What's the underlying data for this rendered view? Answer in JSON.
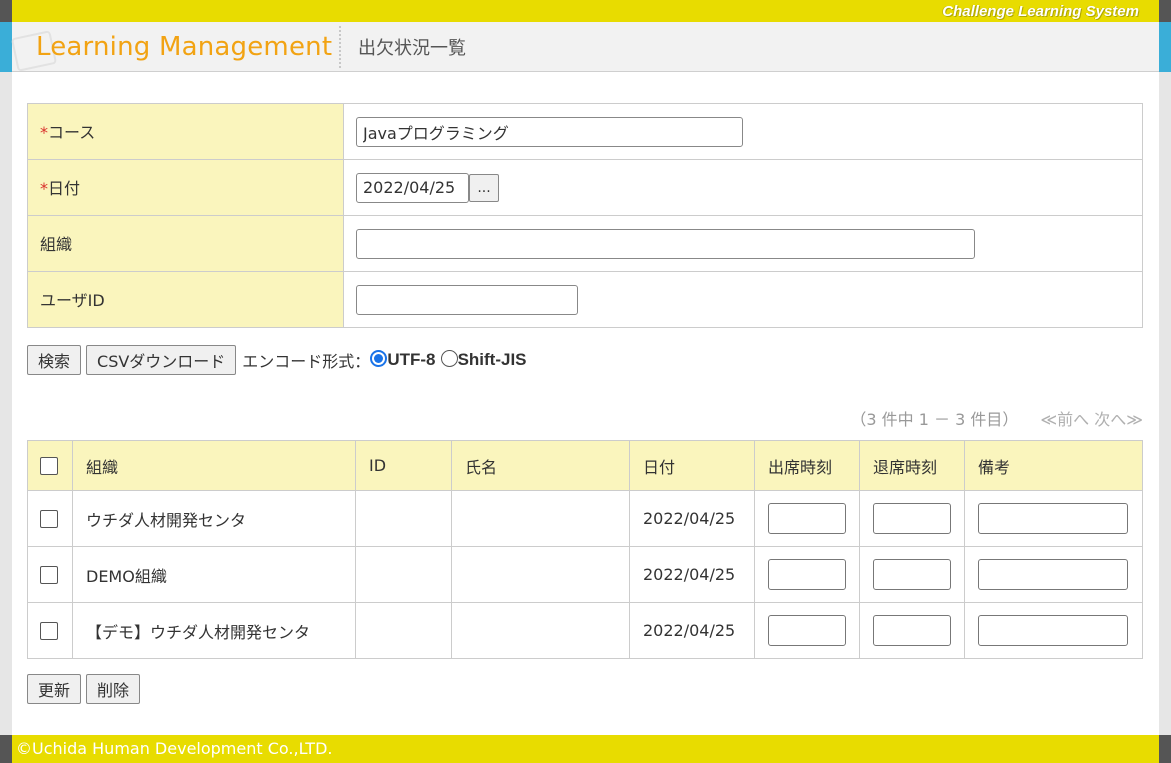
{
  "system": {
    "name": "Challenge Learning System"
  },
  "header": {
    "logo": "Learning Management",
    "page_title": "出欠状況一覧"
  },
  "search_form": {
    "course": {
      "required_mark": "*",
      "label": "コース",
      "value": "Javaプログラミング"
    },
    "date": {
      "required_mark": "*",
      "label": "日付",
      "value": "2022/04/25",
      "picker_label": "..."
    },
    "org": {
      "label": "組織",
      "value": ""
    },
    "user_id": {
      "label": "ユーザID",
      "value": ""
    }
  },
  "actions": {
    "search_label": "検索",
    "csv_label": "CSVダウンロード",
    "encode_label": "エンコード形式：",
    "encodings": [
      "UTF-8",
      "Shift-JIS"
    ],
    "selected_encoding": "UTF-8"
  },
  "pager": {
    "count_text": "（3 件中 1 － 3 件目）",
    "prev": "≪前へ",
    "next": "次へ≫"
  },
  "table": {
    "headers": [
      "組織",
      "ID",
      "氏名",
      "日付",
      "出席時刻",
      "退席時刻",
      "備考"
    ],
    "rows": [
      {
        "org": "ウチダ人材開発センタ",
        "id": "",
        "name": "",
        "date": "2022/04/25"
      },
      {
        "org": "DEMO組織",
        "id": "",
        "name": "",
        "date": "2022/04/25"
      },
      {
        "org": "【デモ】ウチダ人材開発センタ",
        "id": "",
        "name": "",
        "date": "2022/04/25"
      }
    ]
  },
  "bottom_actions": {
    "update_label": "更新",
    "delete_label": "削除"
  },
  "footer": {
    "copyright": "©Uchida Human Development Co.,LTD."
  },
  "colors": {
    "brand_yellow": "#e8dc00",
    "accent_blue": "#3aaed8",
    "logo_orange": "#f2a313",
    "label_bg": "#faf5bd"
  }
}
